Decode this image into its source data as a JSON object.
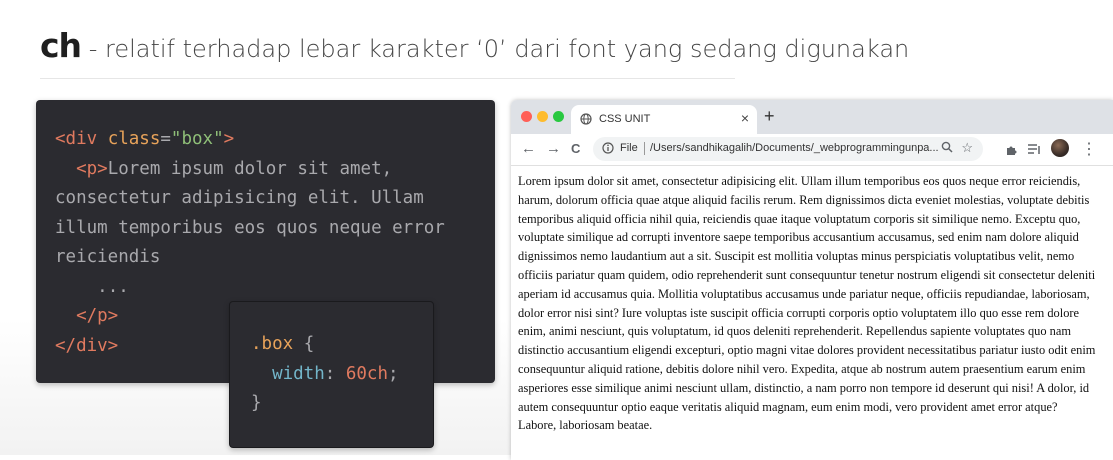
{
  "slide": {
    "unit": "ch",
    "description": " - relatif terhadap lebar karakter ‘0’ dari font yang sedang digunakan"
  },
  "html_code": {
    "l1_open": "<div ",
    "l1_attr": "class",
    "l1_eq": "=",
    "l1_str": "\"box\"",
    "l1_close": ">",
    "l2_tag": "<p>",
    "l2_text": "Lorem ipsum dolor sit amet,",
    "l3_text": "consectetur adipisicing elit. Ullam",
    "l4_text": "illum temporibus eos quos neque error",
    "l5_text": "reiciendis",
    "l6_text": "...",
    "l7_tag": "</p>",
    "l8_tag": "</div>"
  },
  "css_code": {
    "selector": ".box",
    "open_brace": " {",
    "property": "width",
    "colon": ": ",
    "value": "60ch",
    "semicolon": ";",
    "close_brace": "}"
  },
  "browser": {
    "tab_title": "CSS UNIT",
    "tab_close": "×",
    "new_tab": "+",
    "back": "←",
    "forward": "→",
    "reload": "C",
    "scheme_label": "File",
    "url": "/Users/sandhikagalih/Documents/_webprogrammingunpa...",
    "zoom_icon": "search-icon",
    "star_icon": "star-icon",
    "menu": "⋮",
    "page_text": "Lorem ipsum dolor sit amet, consectetur adipisicing elit. Ullam illum temporibus eos quos neque error reiciendis, harum, dolorum officia quae atque aliquid facilis rerum. Rem dignissimos dicta eveniet molestias, voluptate debitis temporibus aliquid officia nihil quia, reiciendis quae itaque voluptatum corporis sit similique nemo. Exceptu quo, voluptate similique ad corrupti inventore saepe temporibus accusantium accusamus, sed enim nam dolore aliquid dignissimos nemo laudantium aut a sit. Suscipit est mollitia voluptas minus perspiciatis voluptatibus velit, nemo officiis pariatur quam quidem, odio reprehenderit sunt consequuntur tenetur nostrum eligendi sit consectetur deleniti aperiam id accusamus quia. Mollitia voluptatibus accusamus unde pariatur neque, officiis repudiandae, laboriosam, dolor error nisi sint? Iure voluptas iste suscipit officia corrupti corporis optio voluptatem illo quo esse rem dolore enim, animi nesciunt, quis voluptatum, id quos deleniti reprehenderit. Repellendus sapiente voluptates quo nam distinctio accusantium eligendi excepturi, optio magni vitae dolores provident necessitatibus pariatur iusto odit enim consequuntur aliquid ratione, debitis dolore nihil vero. Expedita, atque ab nostrum autem praesentium earum enim asperiores esse similique animi nesciunt ullam, distinctio, a nam porro non tempore id deserunt qui nisi! A dolor, id autem consequuntur optio eaque veritatis aliquid magnam, eum enim modi, vero provident amet error atque? Labore, laboriosam beatae."
  }
}
